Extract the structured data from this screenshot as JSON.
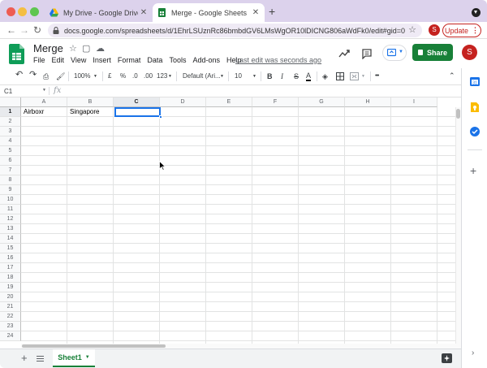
{
  "browser": {
    "tabs": [
      {
        "title": "My Drive - Google Drive",
        "active": false
      },
      {
        "title": "Merge - Google Sheets",
        "active": true
      }
    ],
    "url": "docs.google.com/spreadsheets/d/1EhrLSUznRc86bmbdGV6LMsWgOR10lDICNG806aWdFk0/edit#gid=0",
    "profile_initial": "S",
    "update_label": "Update"
  },
  "doc": {
    "title": "Merge",
    "menu": [
      "File",
      "Edit",
      "View",
      "Insert",
      "Format",
      "Data",
      "Tools",
      "Add-ons",
      "Help"
    ],
    "last_edit": "Last edit was seconds ago",
    "share_label": "Share",
    "avatar_initial": "S"
  },
  "toolbar": {
    "zoom": "100%",
    "currency": "£",
    "percent": "%",
    "dec_decrease": ".0",
    "dec_increase": ".00",
    "more_formats": "123",
    "font": "Default (Ari...",
    "font_size": "10",
    "bold": "B",
    "italic": "I",
    "strike": "S",
    "text_color": "A",
    "more": "•••"
  },
  "formula_bar": {
    "name_box": "C1",
    "fx": "fx",
    "content": ""
  },
  "grid": {
    "columns": [
      "A",
      "B",
      "C",
      "D",
      "E",
      "F",
      "G",
      "H",
      "I"
    ],
    "rows": [
      "1",
      "2",
      "3",
      "4",
      "5",
      "6",
      "7",
      "8",
      "9",
      "10",
      "11",
      "12",
      "13",
      "14",
      "15",
      "16",
      "17",
      "18",
      "19",
      "20",
      "21",
      "22",
      "23",
      "24"
    ],
    "cells": {
      "A1": "Airboxr",
      "B1": "Singapore"
    },
    "selected": "C1"
  },
  "sheets": {
    "add": "+",
    "tabs": [
      "Sheet1"
    ]
  },
  "colors": {
    "accent_green": "#188038",
    "selection_blue": "#1a73e8",
    "tabstrip": "#dcd2ec"
  }
}
